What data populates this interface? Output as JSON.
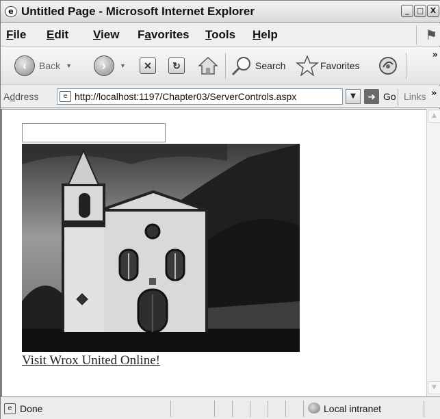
{
  "window": {
    "title": "Untitled Page - Microsoft Internet Explorer",
    "buttons": {
      "minimize": "_",
      "maximize": "□",
      "close": "X"
    }
  },
  "menu": {
    "items": [
      {
        "accel": "F",
        "rest": "ile"
      },
      {
        "accel": "E",
        "rest": "dit"
      },
      {
        "accel": "V",
        "rest": "iew"
      },
      {
        "pre": "F",
        "accel": "a",
        "rest": "vorites"
      },
      {
        "accel": "T",
        "rest": "ools"
      },
      {
        "accel": "H",
        "rest": "elp"
      }
    ]
  },
  "toolbar": {
    "back_label": "Back",
    "search_label": "Search",
    "favorites_label": "Favorites",
    "more": "»"
  },
  "address": {
    "label_pre": "A",
    "label_accel": "d",
    "label_rest": "dress",
    "url": "http://localhost:1197/Chapter03/ServerControls.aspx",
    "go_label": "Go",
    "links_label": "Links",
    "more": "»"
  },
  "content": {
    "textbox_value": "",
    "link_text": "Visit Wrox United Online!"
  },
  "statusbar": {
    "status": "Done",
    "zone": "Local intranet"
  },
  "icons": {
    "ie_page": "page-icon",
    "back": "back-arrow-icon",
    "forward": "forward-arrow-icon",
    "stop": "stop-icon",
    "refresh": "refresh-icon",
    "home": "home-icon",
    "search": "search-icon",
    "favorites": "star-icon",
    "media": "media-icon",
    "go": "go-arrow-icon",
    "zone": "intranet-icon"
  }
}
